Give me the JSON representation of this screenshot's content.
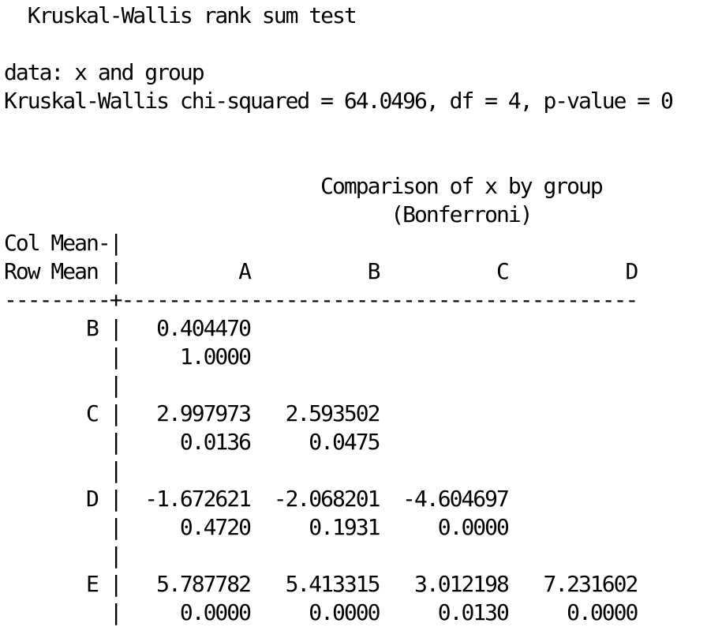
{
  "test": {
    "title": "  Kruskal-Wallis rank sum test",
    "data_line": "data: x and group",
    "stat_line": "Kruskal-Wallis chi-squared = 64.0496, df = 4, p-value = 0"
  },
  "comparison": {
    "title": "                           Comparison of x by group",
    "subtitle": "                                 (Bonferroni)",
    "header_1": "Col Mean-|",
    "header_2": "Row Mean |          A          B          C          D",
    "separator": "---------+--------------------------------------------",
    "rows": [
      {
        "values": "       B |   0.404470",
        "pvalues": "         |     1.0000",
        "spacer": "         |"
      },
      {
        "values": "       C |   2.997973   2.593502",
        "pvalues": "         |     0.0136     0.0475",
        "spacer": "         |"
      },
      {
        "values": "       D |  -1.672621  -2.068201  -4.604697",
        "pvalues": "         |     0.4720     0.1931     0.0000",
        "spacer": "         |"
      },
      {
        "values": "       E |   5.787782   5.413315   3.012198   7.231602",
        "pvalues": "         |     0.0000     0.0000     0.0130     0.0000"
      }
    ]
  }
}
